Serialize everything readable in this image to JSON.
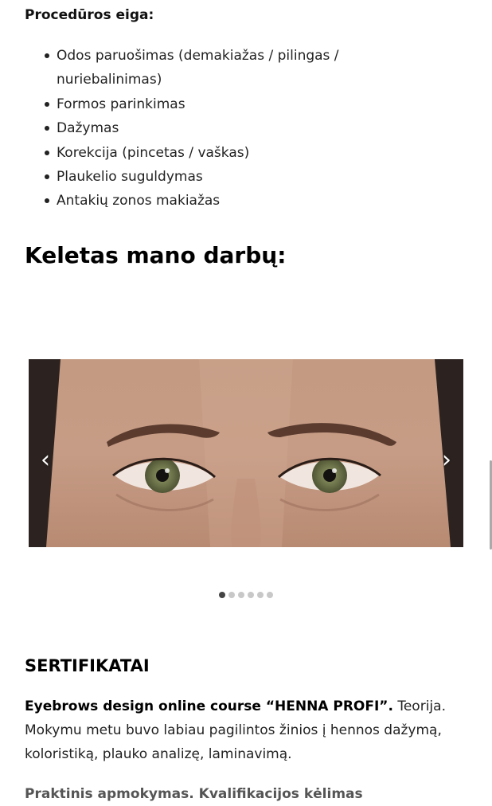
{
  "procedure": {
    "heading": "Procedūros eiga:",
    "steps": [
      "Odos paruošimas (demakiažas / pilingas / nuriebalinimas)",
      "Formos parinkimas",
      "Dažymas",
      "Korekcija (pincetas / vaškas)",
      "Plaukelio suguldymas",
      "Antakių zonos makiažas"
    ]
  },
  "works": {
    "heading": "Keletas mano darbų:"
  },
  "carousel": {
    "prev_label": "‹",
    "next_label": "›",
    "slide_count": 6,
    "active_slide": 1
  },
  "certificates": {
    "heading": "SERTIFIKATAI",
    "item1_title": "Eyebrows design online course “HENNA PROFI”.",
    "item1_text": " Teorija. Mokymu metu buvo labiau pagilintos žinios į hennos dažymą, koloristiką, plauko analizę, laminavimą.",
    "item2_partial": "Praktinis apmokymas. Kvalifikacijos kėlimas"
  },
  "colors": {
    "accent": "#000000",
    "dot_active": "#444444",
    "dot_inactive": "#c8c8c8"
  }
}
